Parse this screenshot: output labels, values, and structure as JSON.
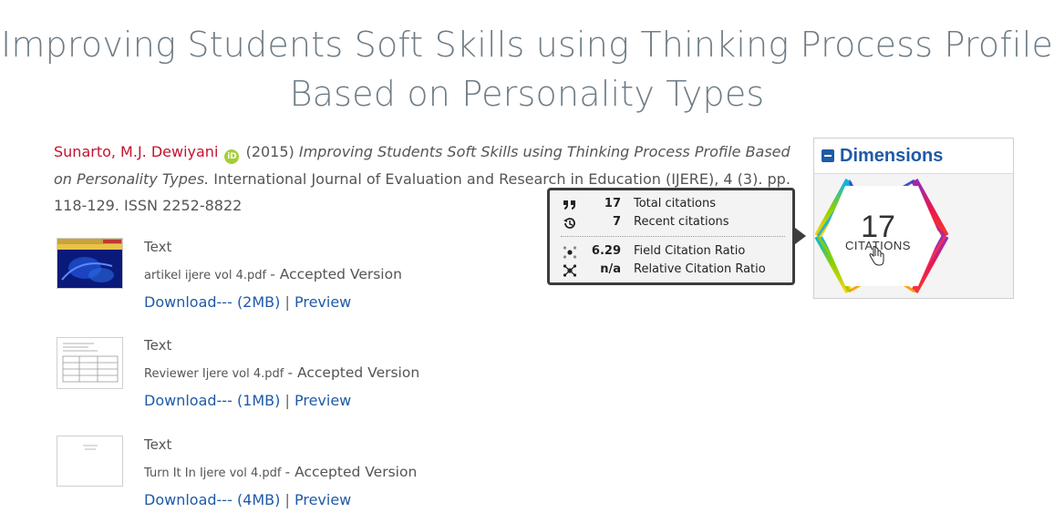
{
  "page": {
    "title": "Improving Students Soft Skills using Thinking Process Profile Based on Personality Types"
  },
  "citation": {
    "authors": "Sunarto, M.J. Dewiyani",
    "orcid_label": "iD",
    "year": "(2015)",
    "title": "Improving Students Soft Skills using Thinking Process Profile Based on Personality Types.",
    "rest": "International Journal of Evaluation and Research in Education (IJERE), 4 (3). pp. 118-129. ISSN 2252-8822"
  },
  "documents": [
    {
      "type": "Text",
      "filename": "artikel ijere vol 4.pdf",
      "version": "- Accepted Version",
      "download": "Download--- (2MB)",
      "preview": "Preview",
      "sep": "|"
    },
    {
      "type": "Text",
      "filename": "Reviewer Ijere vol 4.pdf",
      "version": "- Accepted Version",
      "download": "Download--- (1MB)",
      "preview": "Preview",
      "sep": "|"
    },
    {
      "type": "Text",
      "filename": "Turn It In Ijere vol 4.pdf",
      "version": "- Accepted Version",
      "download": "Download--- (4MB)",
      "preview": "Preview",
      "sep": "|"
    }
  ],
  "dimensions": {
    "title": "Dimensions",
    "count": "17",
    "label": "CITATIONS",
    "popup": [
      {
        "icon": "quote-icon",
        "value": "17",
        "label": "Total citations"
      },
      {
        "icon": "history-icon",
        "value": "7",
        "label": "Recent citations"
      },
      {
        "icon": "field-ratio-icon",
        "value": "6.29",
        "label": "Field Citation Ratio"
      },
      {
        "icon": "relative-ratio-icon",
        "value": "n/a",
        "label": "Relative Citation Ratio"
      }
    ]
  },
  "colors": {
    "title": "#6f7d87",
    "author": "#c4122f",
    "link": "#1f5aa8",
    "orcid": "#a6ce39"
  }
}
